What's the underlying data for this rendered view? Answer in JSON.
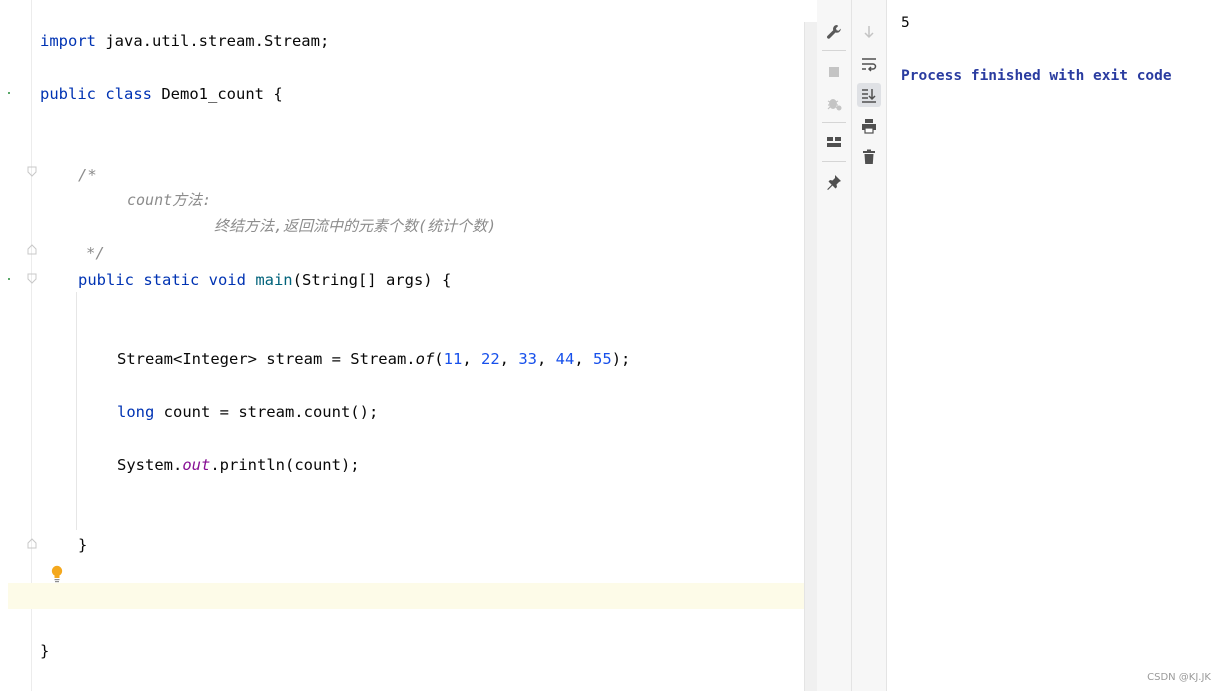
{
  "editor": {
    "import_kw": "import",
    "import_path": " java.util.stream.Stream;",
    "class_public": "public",
    "class_kw": "class",
    "class_name": " Demo1_count {",
    "comment_open": "/*",
    "comment_line1": "count方法:",
    "comment_line2": "终结方法,返回流中的元素个数(统计个数)",
    "comment_close": "*/",
    "main_mods": "public static void",
    "main_name": " main",
    "main_sig": "(String[] args) {",
    "stream_decl": "Stream<Integer> stream = Stream.",
    "stream_of": "of",
    "stream_paren_open": "(",
    "stream_n1": "11",
    "stream_n2": "22",
    "stream_n3": "33",
    "stream_n4": "44",
    "stream_n5": "55",
    "stream_paren_close": ");",
    "count_kw": "long",
    "count_rest": " count = stream.count();",
    "print_sys": "System.",
    "print_out": "out",
    "print_rest": ".println(count);",
    "method_close": "}",
    "class_close": "}"
  },
  "toolbar": {
    "left": [
      "wrench-icon",
      "stop-icon",
      "debug-icon",
      "layout-icon",
      "pin-icon"
    ],
    "right": [
      "down-arrow-icon",
      "soft-wrap-icon",
      "scroll-to-end-icon",
      "print-icon",
      "trash-icon"
    ]
  },
  "console": {
    "output": "5",
    "status": "Process finished with exit code",
    "status_color": "#2a3ca0"
  },
  "watermark": "CSDN @KJ.JK"
}
